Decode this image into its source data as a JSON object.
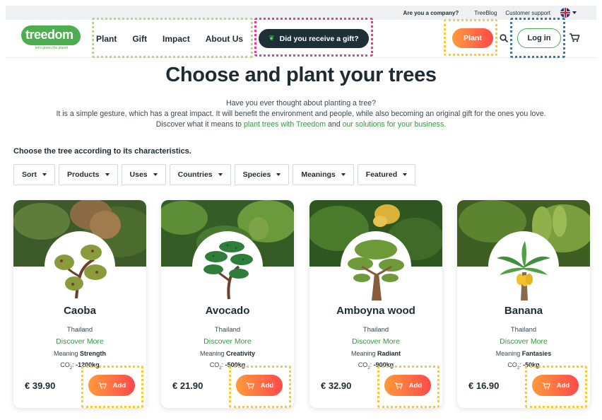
{
  "topbar": {
    "company_link": "Are you a company?",
    "blog_link": "TreeBlog",
    "support_link": "Customer support",
    "language_icon": "uk-flag-icon"
  },
  "header": {
    "logo_text": "treedom",
    "logo_tagline": "let's green the planet",
    "nav": [
      "Plant",
      "Gift",
      "Impact",
      "About Us"
    ],
    "gift_button": "Did you receive a gift?",
    "plant_button": "Plant",
    "search_icon": "search-icon",
    "login_button": "Log in",
    "cart_icon": "cart-icon"
  },
  "hero": {
    "title": "Choose and plant your trees",
    "line1": "Have you ever thought about planting a tree?",
    "line2": "It is a simple gesture, which has a great impact. It will benefit the environment and people, while also becoming an original gift for the ones you love.",
    "line3_prefix": "Discover what it means to ",
    "line3_link1": "plant trees with Treedom",
    "line3_mid": " and ",
    "line3_link2": "our solutions for your business."
  },
  "filters": {
    "heading": "Choose the tree according to its characteristics.",
    "items": [
      "Sort",
      "Products",
      "Uses",
      "Countries",
      "Species",
      "Meanings",
      "Featured"
    ]
  },
  "cards": [
    {
      "name": "Caoba",
      "country": "Thailand",
      "more": "Discover More",
      "meaning_label": "Meaning",
      "meaning": "Strength",
      "co2_label": "CO",
      "co2_sub": "2",
      "co2_value": "-1200kg",
      "price": "€ 39.90",
      "add": "Add"
    },
    {
      "name": "Avocado",
      "country": "Thailand",
      "more": "Discover More",
      "meaning_label": "Meaning",
      "meaning": "Creativity",
      "co2_label": "CO",
      "co2_sub": "2",
      "co2_value": "-500kg",
      "price": "€ 21.90",
      "add": "Add"
    },
    {
      "name": "Amboyna wood",
      "country": "Thailand",
      "more": "Discover More",
      "meaning_label": "Meaning",
      "meaning": "Radiant",
      "co2_label": "CO",
      "co2_sub": "2",
      "co2_value": "-900kg",
      "price": "€ 32.90",
      "add": "Add"
    },
    {
      "name": "Banana",
      "country": "Thailand",
      "more": "Discover More",
      "meaning_label": "Meaning",
      "meaning": "Fantasies",
      "co2_label": "CO",
      "co2_sub": "2",
      "co2_value": "-50kg",
      "price": "€ 16.90",
      "add": "Add"
    }
  ],
  "colors": {
    "brand_green": "#4cae4f",
    "accent_orange": "#ff9a3c",
    "accent_red": "#ff4a4a",
    "dark_button": "#1f2f36",
    "link_green": "#2e9d3a"
  }
}
